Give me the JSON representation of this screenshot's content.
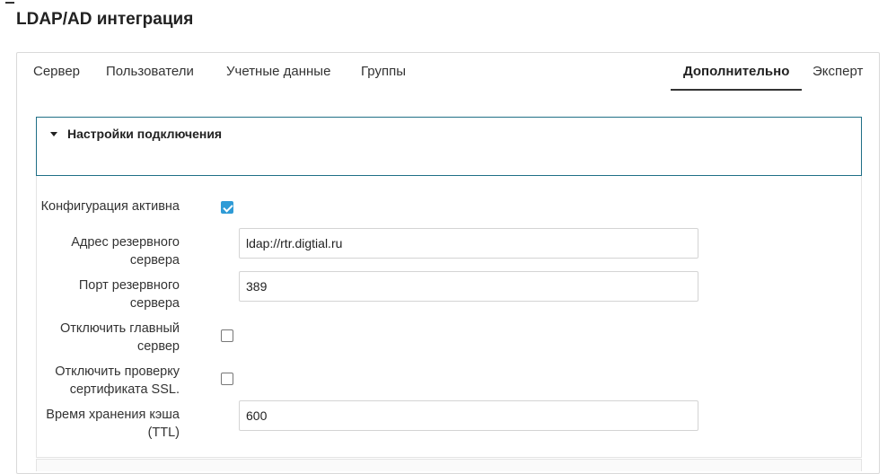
{
  "page": {
    "title": "LDAP/AD интеграция"
  },
  "tabs": [
    {
      "label": "Сервер"
    },
    {
      "label": "Пользователи"
    },
    {
      "label": "Учетные данные"
    },
    {
      "label": "Группы"
    },
    {
      "label": "Дополнительно",
      "active": true
    },
    {
      "label": "Эксперт"
    }
  ],
  "panel": {
    "title": "Настройки подключения",
    "expanded": true
  },
  "fields": {
    "config_active": {
      "label": "Конфигурация активна",
      "checked": true
    },
    "backup_host": {
      "label_line1": "Адрес резервного",
      "label_line2": "сервера",
      "value": "ldap://rtr.digtial.ru"
    },
    "backup_port": {
      "label_line1": "Порт резервного",
      "label_line2": "сервера",
      "value": "389"
    },
    "disable_main": {
      "label_line1": "Отключить главный",
      "label_line2": "сервер",
      "checked": false
    },
    "disable_ssl": {
      "label_line1": "Отключить проверку",
      "label_line2": "сертификата SSL.",
      "checked": false
    },
    "cache_ttl": {
      "label_line1": "Время хранения кэша",
      "label_line2": "(TTL)",
      "value": "600"
    }
  },
  "colors": {
    "accent": "#2f9bd6",
    "panel_border": "#1f6f86"
  }
}
